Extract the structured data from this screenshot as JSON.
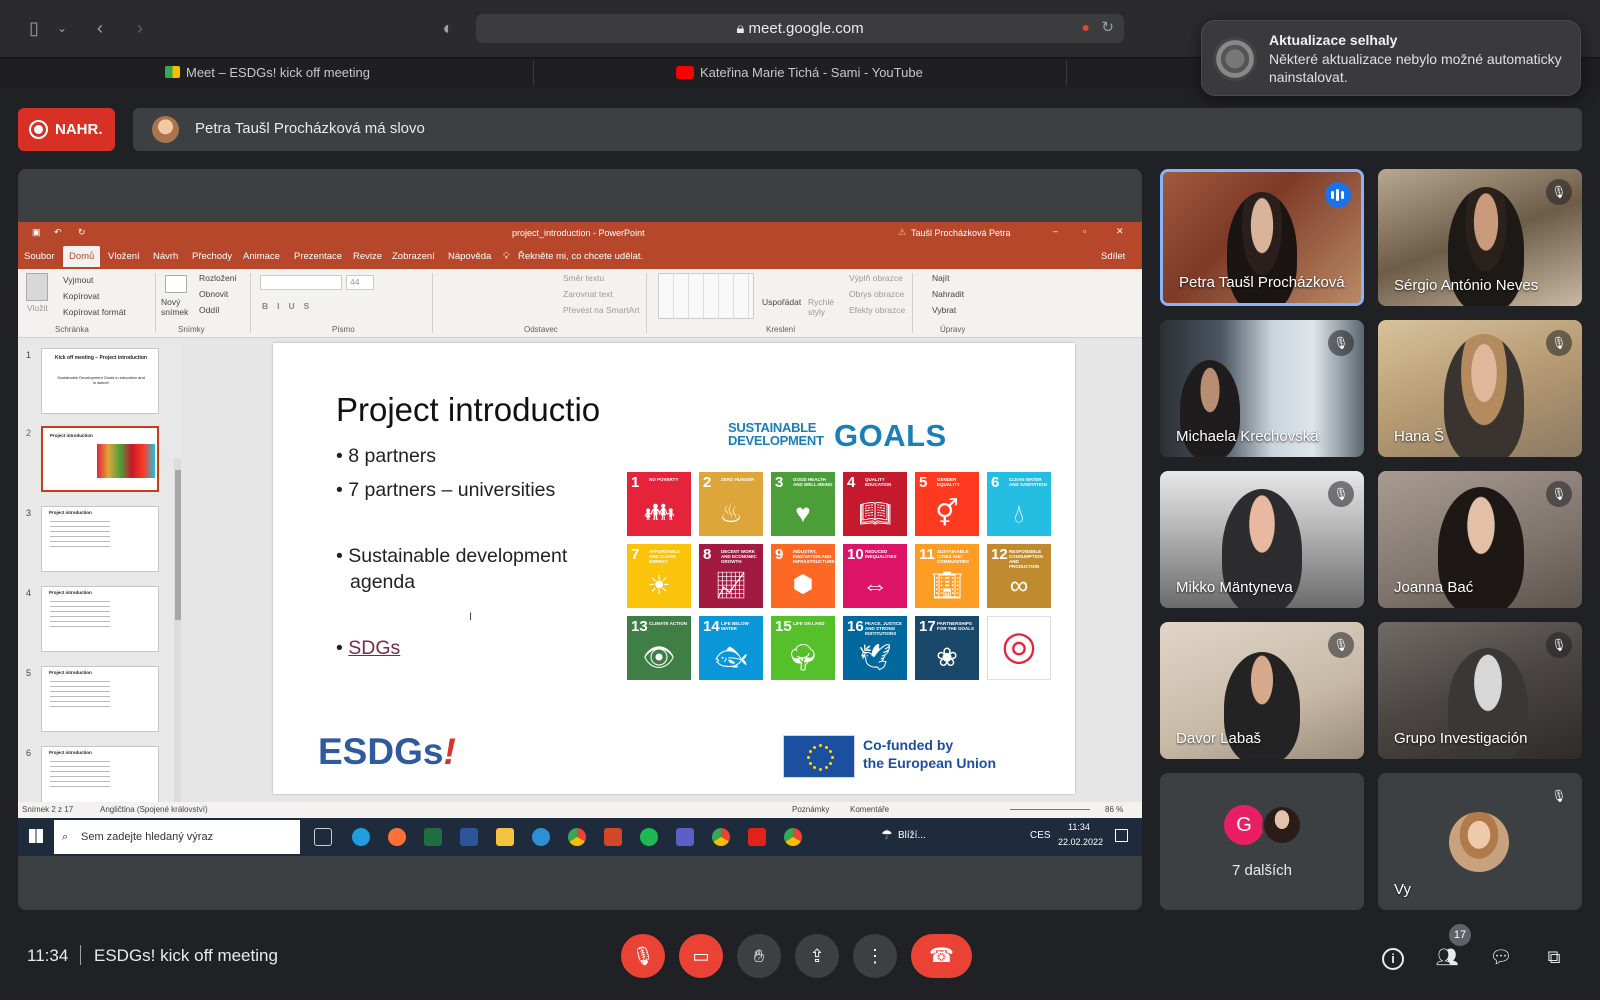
{
  "browser": {
    "url": "meet.google.com",
    "tabs": [
      {
        "label": "Meet – ESDGs! kick off meeting"
      },
      {
        "label": "Kateřina Marie Tichá - Sami - YouTube"
      }
    ]
  },
  "notification": {
    "title": "Aktualizace selhaly",
    "body": "Některé aktualizace nebylo možné automaticky nainstalovat."
  },
  "meet_header": {
    "record_label": "NAHR.",
    "speaker_text": "Petra Taušl Procházková má slovo"
  },
  "powerpoint": {
    "window_title": "project_introduction - PowerPoint",
    "user": "Taušl Procházková Petra",
    "menu": [
      "Soubor",
      "Domů",
      "Vložení",
      "Návrh",
      "Přechody",
      "Animace",
      "Prezentace",
      "Revize",
      "Zobrazení",
      "Nápověda"
    ],
    "tell_me": "Řekněte mi, co chcete udělat.",
    "share": "Sdílet",
    "ribbon": {
      "clipboard": [
        "Vyjmout",
        "Kopírovat",
        "Kopírovat formát"
      ],
      "paste": "Vložit",
      "new_slide": "Nový snímek",
      "slide_cmds": [
        "Rozložení",
        "Obnovit",
        "Oddíl"
      ],
      "font_size": "44",
      "paragraph": [
        "Směr textu",
        "Zarovnat text",
        "Převést na SmartArt"
      ],
      "arrange": "Uspořádat",
      "quick_styles": "Rychlé styly",
      "drawing": [
        "Výplň obrazce",
        "Obrys obrazce",
        "Efekty obrazce"
      ],
      "editing": [
        "Najít",
        "Nahradit",
        "Vybrat"
      ],
      "groups": [
        "Schránka",
        "Snímky",
        "Písmo",
        "Odstavec",
        "Kreslení",
        "Úpravy"
      ]
    },
    "thumbnails": [
      "1",
      "2",
      "3",
      "4",
      "5",
      "6"
    ],
    "thumb1_title": "Kick off meeting – Project introduction",
    "thumb1_sub": "Sustainable Development Goals in education and in action!",
    "thumb_title": "Project introduction",
    "slide": {
      "title": "Project introductio",
      "bullets": [
        "8 partners",
        "7 partners – universities",
        "Sustainable development agenda",
        "SDGs"
      ],
      "sdg_header_small": "SUSTAINABLE DEVELOPMENT",
      "sdg_header_big": "GOALS",
      "sdg_tiles": [
        {
          "n": "1",
          "t": "NO POVERTY",
          "color": "#e5243b",
          "icon": "family-icon"
        },
        {
          "n": "2",
          "t": "ZERO HUNGER",
          "color": "#dda63a",
          "icon": "bowl-icon"
        },
        {
          "n": "3",
          "t": "GOOD HEALTH AND WELL-BEING",
          "color": "#4c9f38",
          "icon": "heartbeat-icon"
        },
        {
          "n": "4",
          "t": "QUALITY EDUCATION",
          "color": "#c5192d",
          "icon": "book-icon"
        },
        {
          "n": "5",
          "t": "GENDER EQUALITY",
          "color": "#ff3a21",
          "icon": "gender-icon"
        },
        {
          "n": "6",
          "t": "CLEAN WATER AND SANITATION",
          "color": "#26bde2",
          "icon": "water-icon"
        },
        {
          "n": "7",
          "t": "AFFORDABLE AND CLEAN ENERGY",
          "color": "#fcc30b",
          "icon": "sun-icon"
        },
        {
          "n": "8",
          "t": "DECENT WORK AND ECONOMIC GROWTH",
          "color": "#a21942",
          "icon": "growth-chart-icon"
        },
        {
          "n": "9",
          "t": "INDUSTRY, INNOVATION AND INFRASTRUCTURE",
          "color": "#fd6925",
          "icon": "cubes-icon"
        },
        {
          "n": "10",
          "t": "REDUCED INEQUALITIES",
          "color": "#dd1367",
          "icon": "equality-icon"
        },
        {
          "n": "11",
          "t": "SUSTAINABLE CITIES AND COMMUNITIES",
          "color": "#fd9d24",
          "icon": "city-icon"
        },
        {
          "n": "12",
          "t": "RESPONSIBLE CONSUMPTION AND PRODUCTION",
          "color": "#bf8b2e",
          "icon": "infinity-icon"
        },
        {
          "n": "13",
          "t": "CLIMATE ACTION",
          "color": "#3f7e44",
          "icon": "eye-globe-icon"
        },
        {
          "n": "14",
          "t": "LIFE BELOW WATER",
          "color": "#0a97d9",
          "icon": "fish-icon"
        },
        {
          "n": "15",
          "t": "LIFE ON LAND",
          "color": "#56c02b",
          "icon": "tree-icon"
        },
        {
          "n": "16",
          "t": "PEACE, JUSTICE AND STRONG INSTITUTIONS",
          "color": "#00689d",
          "icon": "dove-icon"
        },
        {
          "n": "17",
          "t": "PARTNERSHIPS FOR THE GOALS",
          "color": "#19486a",
          "icon": "rings-icon"
        },
        {
          "n": "",
          "t": "",
          "color": "#ffffff",
          "icon": "sdg-wheel-icon"
        }
      ],
      "logo_text": "ESDGs",
      "logo_bang": "!",
      "eu_line1": "Co-funded by",
      "eu_line2": "the European Union"
    },
    "status": {
      "slide_count": "Snímek 2 z 17",
      "language": "Angličtina (Spojené království)",
      "notes": "Poznámky",
      "comments": "Komentáře",
      "zoom": "86 %"
    },
    "taskbar": {
      "search_placeholder": "Sem zadejte hledaný výraz",
      "weather": "Blíží...",
      "lang": "CES",
      "time": "11:34",
      "date": "22.02.2022"
    }
  },
  "participants": [
    {
      "name": "Petra Taušl Procházková",
      "speaking": true
    },
    {
      "name": "Sérgio António Neves",
      "muted": true
    },
    {
      "name": "Michaela Krechovská",
      "muted": true
    },
    {
      "name": "Hana Š",
      "muted": true
    },
    {
      "name": "Mikko Mäntyneva",
      "muted": true
    },
    {
      "name": "Joanna Bać",
      "muted": true
    },
    {
      "name": "Davor Labaš",
      "muted": true
    },
    {
      "name": "Grupo Investigación",
      "muted": true
    }
  ],
  "others_tile": {
    "avatar_letter": "G",
    "label": "7 dalších"
  },
  "self_tile": {
    "label": "Vy"
  },
  "bottom_bar": {
    "time": "11:34",
    "meeting_title": "ESDGs! kick off meeting",
    "participant_count": "17"
  }
}
